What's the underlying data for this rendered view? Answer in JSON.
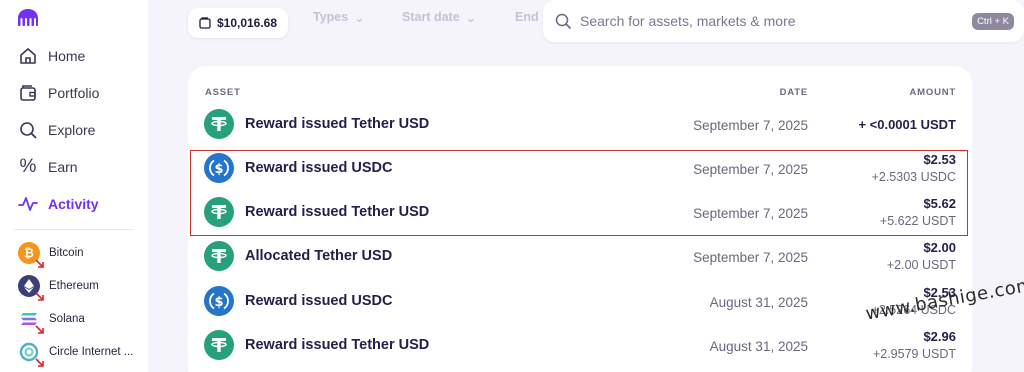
{
  "sidebar": {
    "nav": [
      {
        "label": "Home",
        "icon": "home-icon"
      },
      {
        "label": "Portfolio",
        "icon": "portfolio-icon"
      },
      {
        "label": "Explore",
        "icon": "search-icon"
      },
      {
        "label": "Earn",
        "icon": "percent-icon"
      },
      {
        "label": "Activity",
        "icon": "activity-icon",
        "active": true
      }
    ],
    "assets": [
      {
        "label": "Bitcoin",
        "color": "#f7931a",
        "symbol": "₿"
      },
      {
        "label": "Ethereum",
        "color": "#3b3f77",
        "symbol": "◆"
      },
      {
        "label": "Solana",
        "color": "#9b7cf0",
        "symbol": "≡"
      },
      {
        "label": "Circle Internet ...",
        "color": "#5fb8c9",
        "symbol": "◎"
      }
    ]
  },
  "header": {
    "balance": "$10,016.68",
    "filters": [
      "Types",
      "Start date",
      "End"
    ],
    "search_placeholder": "Search for assets, markets & more",
    "shortcut": "Ctrl + K"
  },
  "table": {
    "columns": {
      "asset": "ASSET",
      "date": "DATE",
      "amount": "AMOUNT"
    },
    "rows": [
      {
        "title": "Reward issued Tether USD",
        "date": "September 7, 2025",
        "main": "+ <0.0001 USDT",
        "sub": "",
        "coin": "usdt"
      },
      {
        "title": "Reward issued USDC",
        "date": "September 7, 2025",
        "main": "$2.53",
        "sub": "+2.5303 USDC",
        "coin": "usdc"
      },
      {
        "title": "Reward issued Tether USD",
        "date": "September 7, 2025",
        "main": "$5.62",
        "sub": "+5.622 USDT",
        "coin": "usdt"
      },
      {
        "title": "Allocated Tether USD",
        "date": "September 7, 2025",
        "main": "$2.00",
        "sub": "+2.00 USDT",
        "coin": "usdt"
      },
      {
        "title": "Reward issued USDC",
        "date": "August 31, 2025",
        "main": "$2.53",
        "sub": "+2.5264 USDC",
        "coin": "usdc"
      },
      {
        "title": "Reward issued Tether USD",
        "date": "August 31, 2025",
        "main": "$2.96",
        "sub": "+2.9579 USDT",
        "coin": "usdt"
      }
    ]
  },
  "watermark": "www.bashige.com",
  "colors": {
    "accent": "#7132f5",
    "usdt": "#26a17b",
    "usdc": "#2775ca",
    "highlight": "#c9342d"
  }
}
